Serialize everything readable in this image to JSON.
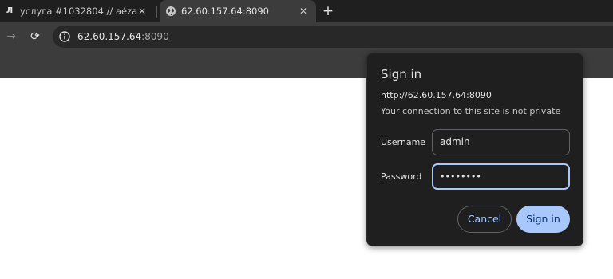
{
  "tabs": [
    {
      "favicon_text": "Л",
      "title": "услуга #1032804 // aéza",
      "close": "✕",
      "active": false
    },
    {
      "favicon_icon": "globe-icon",
      "title": "62.60.157.64:8090",
      "close": "✕",
      "active": true
    }
  ],
  "new_tab": "+",
  "toolbar": {
    "forward": "→",
    "reload": "⟳",
    "url_host": "62.60.157.64",
    "url_port": ":8090"
  },
  "dialog": {
    "title": "Sign in",
    "origin": "http://62.60.157.64:8090",
    "warning": "Your connection to this site is not private",
    "username_label": "Username",
    "username_value": "admin",
    "password_label": "Password",
    "password_value": "••••••••",
    "cancel_label": "Cancel",
    "signin_label": "Sign in"
  },
  "colors": {
    "accent": "#a8c7fa",
    "dialog_bg": "#1f1f1f",
    "toolbar_bg": "#3c3c3c"
  }
}
